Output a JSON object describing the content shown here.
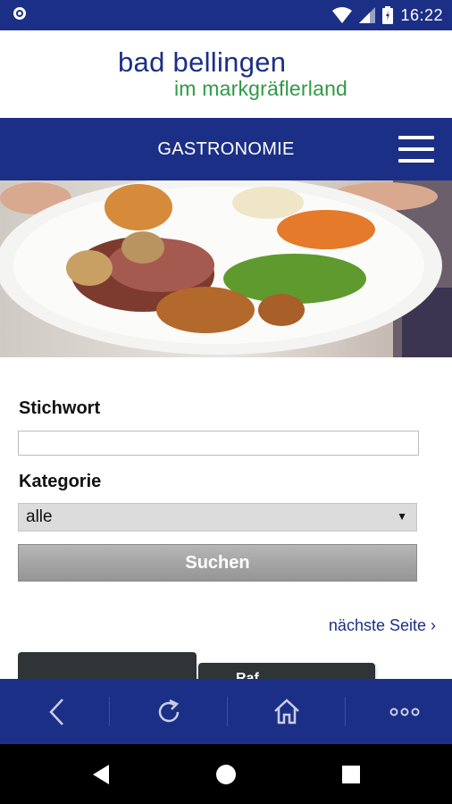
{
  "status_bar": {
    "time": "16:22"
  },
  "header": {
    "logo_line1": "bad bellingen",
    "logo_line2": "im markgräflerland"
  },
  "navbar": {
    "title": "GASTRONOMIE"
  },
  "form": {
    "keyword_label": "Stichwort",
    "keyword_value": "",
    "category_label": "Kategorie",
    "category_selected": "alle",
    "search_button": "Suchen",
    "next_page_link": "nächste Seite ›"
  },
  "tiles": {
    "second_tile_text": "Raf..."
  },
  "colors": {
    "brand_blue": "#1c2f86",
    "brand_green": "#2f9a45",
    "button_gray": "#a6a6a6"
  },
  "bottom_bar": {
    "icons": [
      "back-icon",
      "reload-icon",
      "home-icon",
      "more-icon"
    ]
  },
  "android_nav": {
    "icons": [
      "back-triangle-icon",
      "home-circle-icon",
      "recents-square-icon"
    ]
  }
}
